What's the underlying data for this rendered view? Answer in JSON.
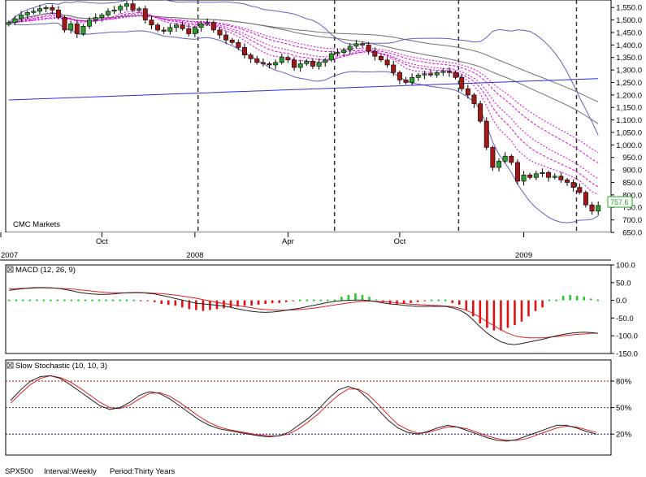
{
  "footer": {
    "symbol": "SPX500",
    "interval": "Interval:Weekly",
    "period": "Period:Thirty Years"
  },
  "watermark": "CMC Markets",
  "last_price_label": "757.6",
  "colors": {
    "bull": "#2e9c2e",
    "bear": "#a01818",
    "ma_magenta": "#e000e0",
    "ma_gray": "#707070",
    "ma_blue": "#3030d0",
    "bollinger": "#6060c0",
    "macd_line": "#202020",
    "signal_line": "#e02020",
    "hist_pos": "#22cc22",
    "hist_neg": "#e01010",
    "stoch_k": "#202020",
    "stoch_d": "#e02020",
    "stoch_high": "#c00000",
    "stoch_mid": "#404040",
    "stoch_low": "#000090"
  },
  "chart_data": [
    {
      "type": "candlestick",
      "title": "",
      "ylim": [
        650,
        1580
      ],
      "y_ticks": [
        "650.0",
        "700.0",
        "750.0",
        "800.0",
        "850.0",
        "900.0",
        "950.0",
        "1,000.0",
        "1,050.0",
        "1,100.0",
        "1,150.0",
        "1,200.0",
        "1,250.0",
        "1,300.0",
        "1,350.0",
        "1,400.0",
        "1,450.0",
        "1,500.0",
        "1,550.0"
      ],
      "x_labels": [
        "2007",
        "Oct",
        "2008",
        "Apr",
        "Oct",
        "2009"
      ],
      "event_markers": [
        "2007-12",
        "2008-05",
        "2008-10",
        "2009-02"
      ],
      "closes": [
        1490,
        1505,
        1520,
        1530,
        1535,
        1545,
        1550,
        1540,
        1510,
        1460,
        1485,
        1445,
        1475,
        1500,
        1510,
        1520,
        1535,
        1540,
        1555,
        1565,
        1540,
        1545,
        1500,
        1480,
        1460,
        1455,
        1470,
        1480,
        1465,
        1445,
        1470,
        1485,
        1490,
        1460,
        1440,
        1420,
        1410,
        1390,
        1360,
        1345,
        1330,
        1325,
        1320,
        1330,
        1350,
        1340,
        1310,
        1325,
        1335,
        1315,
        1330,
        1340,
        1365,
        1370,
        1380,
        1395,
        1405,
        1400,
        1375,
        1355,
        1340,
        1320,
        1290,
        1260,
        1250,
        1270,
        1280,
        1285,
        1280,
        1290,
        1295,
        1290,
        1270,
        1225,
        1200,
        1165,
        1095,
        990,
        910,
        935,
        955,
        930,
        855,
        880,
        870,
        885,
        890,
        870,
        875,
        860,
        850,
        830,
        810,
        760,
        735,
        757.6
      ]
    },
    {
      "type": "line",
      "title": "MACD (12, 26, 9)",
      "ylim": [
        -150,
        100
      ],
      "y_ticks": [
        "100.0",
        "50.0",
        "0.0",
        "-50.0",
        "-100.0",
        "-150.0"
      ],
      "series": [
        {
          "name": "MACD",
          "values": [
            28,
            31,
            33,
            35,
            36,
            36,
            35,
            34,
            31,
            27,
            23,
            20,
            18,
            17,
            17,
            18,
            20,
            21,
            22,
            22,
            20,
            18,
            14,
            10,
            5,
            1,
            -4,
            -8,
            -10,
            -12,
            -14,
            -16,
            -20,
            -24,
            -28,
            -31,
            -33,
            -34,
            -33,
            -31,
            -28,
            -25,
            -22,
            -18,
            -14,
            -10,
            -6,
            -3,
            -1,
            0,
            1,
            1,
            -1,
            -4,
            -7,
            -10,
            -12,
            -14,
            -16,
            -17,
            -17,
            -17,
            -17,
            -17,
            -21,
            -27,
            -38,
            -55,
            -75,
            -92,
            -106,
            -117,
            -123,
            -125,
            -122,
            -118,
            -114,
            -110,
            -105,
            -100,
            -96,
            -93,
            -91,
            -90,
            -91,
            -93
          ]
        },
        {
          "name": "Signal",
          "values": [
            32,
            33,
            34,
            34,
            35,
            35,
            35,
            34,
            33,
            32,
            30,
            28,
            26,
            24,
            22,
            21,
            21,
            21,
            21,
            21,
            21,
            20,
            19,
            17,
            15,
            12,
            9,
            6,
            2,
            -2,
            -6,
            -9,
            -12,
            -15,
            -18,
            -21,
            -24,
            -26,
            -27,
            -28,
            -28,
            -27,
            -26,
            -24,
            -22,
            -19,
            -16,
            -13,
            -10,
            -7,
            -5,
            -3,
            -2,
            -3,
            -4,
            -5,
            -7,
            -9,
            -11,
            -12,
            -13,
            -14,
            -15,
            -16,
            -18,
            -22,
            -28,
            -37,
            -48,
            -60,
            -72,
            -83,
            -93,
            -100,
            -104,
            -106,
            -106,
            -106,
            -104,
            -102,
            -100,
            -98,
            -96,
            -95,
            -93,
            -93
          ]
        },
        {
          "name": "Histogram",
          "values": [
            0,
            0,
            0,
            0,
            0,
            0,
            0,
            0,
            0,
            0,
            0,
            0,
            0,
            0,
            0,
            0,
            0,
            0,
            0,
            -1,
            -1,
            -2,
            -4,
            -5,
            -6,
            -8,
            -10,
            -11,
            -12,
            -11,
            -10,
            -9,
            -8,
            -7,
            -6,
            -6,
            -5,
            -4,
            -3,
            -3,
            -2,
            -1,
            0,
            0,
            0,
            0,
            0,
            0,
            4,
            6,
            8,
            6,
            4,
            1,
            -2,
            -4,
            -5,
            -4,
            -3,
            -2,
            -1,
            0,
            0,
            0,
            -3,
            -5,
            -11,
            -18,
            -26,
            -31,
            -34,
            -34,
            -31,
            -28,
            -24,
            -18,
            -12,
            -8,
            0,
            0,
            5,
            6,
            5,
            4,
            2,
            0
          ]
        }
      ]
    },
    {
      "type": "line",
      "title": "Slow Stochastic (10, 10, 3)",
      "ylim": [
        0,
        100
      ],
      "y_ticks": [
        "80%",
        "50%",
        "20%"
      ],
      "reference_levels": [
        80,
        50,
        20
      ],
      "series": [
        {
          "name": "%K",
          "values": [
            58,
            70,
            80,
            85,
            86,
            83,
            76,
            68,
            60,
            52,
            48,
            50,
            56,
            64,
            68,
            66,
            60,
            52,
            44,
            36,
            30,
            26,
            24,
            22,
            20,
            18,
            17,
            18,
            22,
            30,
            38,
            48,
            60,
            70,
            74,
            70,
            60,
            48,
            36,
            27,
            22,
            20,
            23,
            27,
            30,
            28,
            24,
            20,
            16,
            13,
            12,
            14,
            18,
            22,
            26,
            30,
            30,
            27,
            23,
            20
          ]
        },
        {
          "name": "%D",
          "values": [
            55,
            66,
            76,
            83,
            86,
            84,
            79,
            72,
            64,
            56,
            50,
            49,
            53,
            60,
            66,
            67,
            63,
            56,
            48,
            40,
            33,
            28,
            25,
            23,
            21,
            19,
            18,
            18,
            20,
            26,
            34,
            43,
            54,
            64,
            71,
            71,
            65,
            54,
            42,
            31,
            25,
            21,
            22,
            25,
            28,
            28,
            26,
            22,
            18,
            15,
            13,
            13,
            15,
            19,
            23,
            27,
            29,
            28,
            25,
            22
          ]
        }
      ]
    }
  ]
}
